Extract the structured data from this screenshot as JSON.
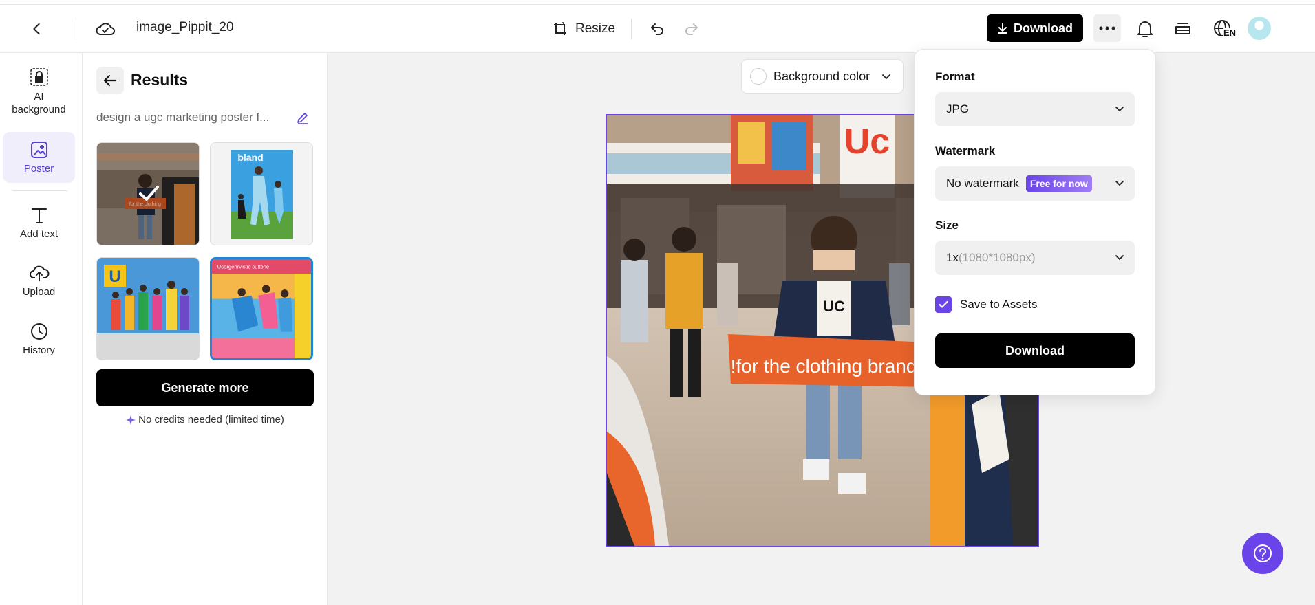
{
  "header": {
    "title": "image_Pippit_20",
    "resize_label": "Resize",
    "download_label": "Download",
    "language_badge": "EN"
  },
  "rail": {
    "items": [
      {
        "label": "AI background",
        "icon": "ai-background-icon"
      },
      {
        "label": "Poster",
        "icon": "poster-icon",
        "active": true
      },
      {
        "label": "Add text",
        "icon": "text-icon"
      },
      {
        "label": "Upload",
        "icon": "upload-icon"
      },
      {
        "label": "History",
        "icon": "history-icon"
      }
    ]
  },
  "results": {
    "title": "Results",
    "prompt": "design a ugc marketing poster f...",
    "thumbnails": [
      {
        "label": "!for the clothing brand",
        "selected": true
      },
      {
        "label": "bland"
      },
      {
        "label": "U"
      },
      {
        "label": "Usergenrvistic cultone"
      }
    ],
    "generate_label": "Generate more",
    "credits_note": "No credits needed (limited time)"
  },
  "canvas": {
    "background_color_label": "Background color",
    "poster_banner_text": "!for the clothing brand\""
  },
  "download_panel": {
    "format_label": "Format",
    "format_value": "JPG",
    "watermark_label": "Watermark",
    "watermark_value": "No watermark",
    "watermark_badge": "Free for now",
    "size_label": "Size",
    "size_value": "1x",
    "size_detail": "(1080*1080px)",
    "save_assets_label": "Save to Assets",
    "save_assets_checked": true,
    "download_label": "Download"
  },
  "colors": {
    "accent": "#6a44e8",
    "primary_button": "#000000",
    "canvas_bg": "#f2f2f2"
  }
}
